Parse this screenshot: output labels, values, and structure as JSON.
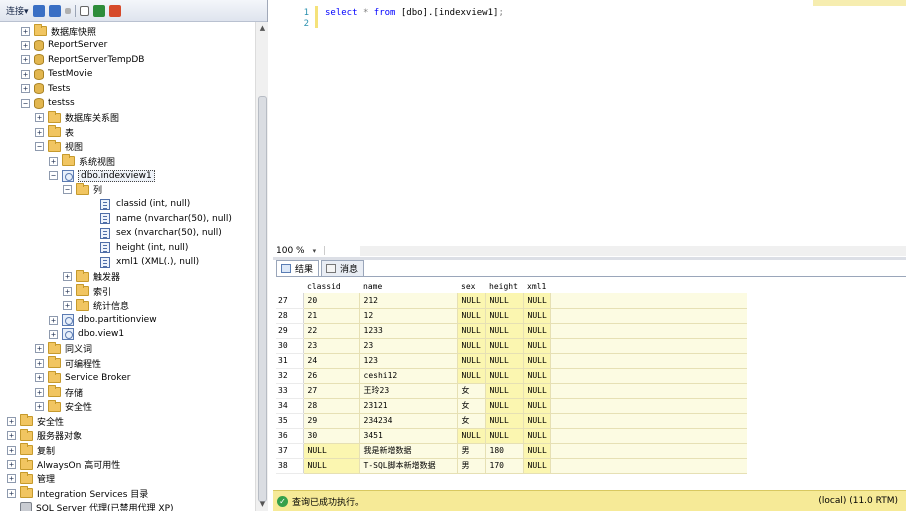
{
  "explorer": {
    "toolbar": {
      "connect_label": "连接",
      "connect_arrow": "▾"
    },
    "tree": [
      {
        "label": "数据库快照",
        "indent": 2,
        "icon": "folder",
        "exp": "+"
      },
      {
        "label": "ReportServer",
        "indent": 2,
        "icon": "db",
        "exp": "+"
      },
      {
        "label": "ReportServerTempDB",
        "indent": 2,
        "icon": "db",
        "exp": "+"
      },
      {
        "label": "TestMovie",
        "indent": 2,
        "icon": "db",
        "exp": "+"
      },
      {
        "label": "Tests",
        "indent": 2,
        "icon": "db",
        "exp": "+"
      },
      {
        "label": "testss",
        "indent": 2,
        "icon": "db",
        "exp": "−"
      },
      {
        "label": "数据库关系图",
        "indent": 3,
        "icon": "folder",
        "exp": "+"
      },
      {
        "label": "表",
        "indent": 3,
        "icon": "folder",
        "exp": "+"
      },
      {
        "label": "视图",
        "indent": 3,
        "icon": "folder",
        "exp": "−"
      },
      {
        "label": "系统视图",
        "indent": 4,
        "icon": "folder",
        "exp": "+"
      },
      {
        "label": "dbo.indexview1",
        "indent": 4,
        "icon": "view",
        "exp": "−",
        "selected": true
      },
      {
        "label": "列",
        "indent": 5,
        "icon": "folder",
        "exp": "−"
      },
      {
        "label": "classid (int, null)",
        "indent": 6,
        "icon": "col",
        "exp": ""
      },
      {
        "label": "name (nvarchar(50), null)",
        "indent": 6,
        "icon": "col",
        "exp": ""
      },
      {
        "label": "sex (nvarchar(50), null)",
        "indent": 6,
        "icon": "col",
        "exp": ""
      },
      {
        "label": "height (int, null)",
        "indent": 6,
        "icon": "col",
        "exp": ""
      },
      {
        "label": "xml1 (XML(.), null)",
        "indent": 6,
        "icon": "col",
        "exp": ""
      },
      {
        "label": "触发器",
        "indent": 5,
        "icon": "folder",
        "exp": "+"
      },
      {
        "label": "索引",
        "indent": 5,
        "icon": "folder",
        "exp": "+"
      },
      {
        "label": "统计信息",
        "indent": 5,
        "icon": "folder",
        "exp": "+"
      },
      {
        "label": "dbo.partitionview",
        "indent": 4,
        "icon": "view",
        "exp": "+"
      },
      {
        "label": "dbo.view1",
        "indent": 4,
        "icon": "view",
        "exp": "+"
      },
      {
        "label": "同义词",
        "indent": 3,
        "icon": "folder",
        "exp": "+"
      },
      {
        "label": "可编程性",
        "indent": 3,
        "icon": "folder",
        "exp": "+"
      },
      {
        "label": "Service Broker",
        "indent": 3,
        "icon": "folder",
        "exp": "+"
      },
      {
        "label": "存储",
        "indent": 3,
        "icon": "folder",
        "exp": "+"
      },
      {
        "label": "安全性",
        "indent": 3,
        "icon": "folder",
        "exp": "+"
      },
      {
        "label": "安全性",
        "indent": 1,
        "icon": "folder",
        "exp": "+"
      },
      {
        "label": "服务器对象",
        "indent": 1,
        "icon": "folder",
        "exp": "+"
      },
      {
        "label": "复制",
        "indent": 1,
        "icon": "folder",
        "exp": "+"
      },
      {
        "label": "AlwaysOn 高可用性",
        "indent": 1,
        "icon": "folder",
        "exp": "+"
      },
      {
        "label": "管理",
        "indent": 1,
        "icon": "folder",
        "exp": "+"
      },
      {
        "label": "Integration Services 目录",
        "indent": 1,
        "icon": "folder",
        "exp": "+"
      },
      {
        "label": "SQL Server 代理(已禁用代理 XP)",
        "indent": 1,
        "icon": "agent",
        "exp": ""
      }
    ]
  },
  "editor": {
    "line_numbers": [
      "1",
      "2"
    ],
    "code": {
      "kw1": "select",
      "star": "*",
      "kw2": "from",
      "obj": "[dbo].[indexview1]",
      "semi": ";"
    },
    "zoom": "100 %"
  },
  "tabs": {
    "results": "结果",
    "messages": "消息"
  },
  "grid": {
    "columns": [
      "classid",
      "name",
      "sex",
      "height",
      "xml1"
    ],
    "rows": [
      [
        "27",
        "20",
        "212",
        "NULL",
        "NULL",
        "NULL"
      ],
      [
        "28",
        "21",
        "12",
        "NULL",
        "NULL",
        "NULL"
      ],
      [
        "29",
        "22",
        "1233",
        "NULL",
        "NULL",
        "NULL"
      ],
      [
        "30",
        "23",
        "23",
        "NULL",
        "NULL",
        "NULL"
      ],
      [
        "31",
        "24",
        "123",
        "NULL",
        "NULL",
        "NULL"
      ],
      [
        "32",
        "26",
        "ceshi12",
        "NULL",
        "NULL",
        "NULL"
      ],
      [
        "33",
        "27",
        "王玲23",
        "女",
        "NULL",
        "NULL"
      ],
      [
        "34",
        "28",
        "23121",
        "女",
        "NULL",
        "NULL"
      ],
      [
        "35",
        "29",
        "234234",
        "女",
        "NULL",
        "NULL"
      ],
      [
        "36",
        "30",
        "3451",
        "NULL",
        "NULL",
        "NULL"
      ],
      [
        "37",
        "NULL",
        "我是新增数据",
        "男",
        "180",
        "NULL"
      ],
      [
        "38",
        "NULL",
        "T-SQL脚本新增数据",
        "男",
        "170",
        "NULL"
      ]
    ]
  },
  "status": {
    "message": "查询已成功执行。",
    "server": "(local) (11.0 RTM)"
  }
}
